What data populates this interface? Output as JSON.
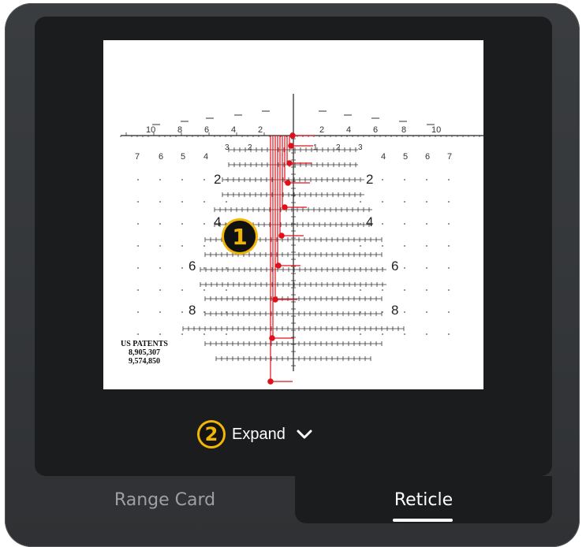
{
  "reticle": {
    "top_scale_left": [
      "10",
      "8",
      "6",
      "4",
      "2"
    ],
    "top_scale_right": [
      "2",
      "4",
      "6",
      "8",
      "10"
    ],
    "row_numbers_left": [
      "7",
      "6",
      "5",
      "4"
    ],
    "row_numbers_right": [
      "4",
      "5",
      "6",
      "7"
    ],
    "center_small_left": [
      "3",
      "2"
    ],
    "center_small_right": [
      "1",
      "2",
      "3"
    ],
    "left_labels": [
      "2",
      "4",
      "6",
      "8"
    ],
    "right_labels": [
      "2",
      "4",
      "6",
      "8"
    ],
    "patent_title": "US PATENTS",
    "patent_1": "8,905,307",
    "patent_2": "9,574,850",
    "accent_color": "#e0101a"
  },
  "callouts": {
    "one": "1",
    "two": "2",
    "color": "#f2b705"
  },
  "expand": {
    "label": "Expand",
    "icon": "chevron-down-icon"
  },
  "tabs": {
    "range_card": "Range Card",
    "reticle": "Reticle",
    "active": "Reticle"
  }
}
